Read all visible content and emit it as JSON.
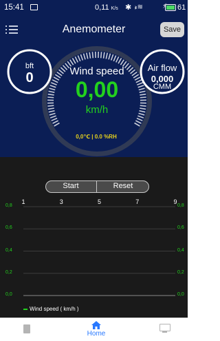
{
  "status_bar": {
    "time": "15:41",
    "network_speed": "0,11",
    "network_unit": "K/s",
    "battery": "61"
  },
  "app_bar": {
    "title": "Anemometer",
    "save_label": "Save"
  },
  "gauge": {
    "label": "Wind speed",
    "value": "0,00",
    "unit": "km/h",
    "temp_humidity": "0,0℃ | 0.0 %RH",
    "level": 0
  },
  "bft": {
    "label": "bft",
    "value": "0"
  },
  "airflow": {
    "label": "Air flow",
    "value": "0,000",
    "unit": "CMM"
  },
  "controls": {
    "start_label": "Start",
    "reset_label": "Reset"
  },
  "chart_data": {
    "type": "line",
    "series": [
      {
        "name": "Wind speed ( km/h )",
        "x": [],
        "values": []
      }
    ],
    "x_ticks": [
      "1",
      "3",
      "5",
      "7",
      "9"
    ],
    "y_ticks": [
      "0,0",
      "0,2",
      "0,4",
      "0,6",
      "0,8"
    ],
    "xlim": [
      1,
      9
    ],
    "ylim": [
      0,
      0.8
    ],
    "grid": true,
    "legend_position": "bottom-left",
    "colors": {
      "line": "#23d11e",
      "axis_text": "#23d11e"
    }
  },
  "legend": {
    "label": "Wind speed ( km/h )"
  },
  "bottom_nav": {
    "home_label": "Home"
  },
  "colors": {
    "primary": "#0b1e55",
    "accent_green": "#23d11e",
    "accent_yellow": "#e8d21c",
    "chart_bg": "#1a1a1a",
    "nav_active": "#2979ff"
  }
}
